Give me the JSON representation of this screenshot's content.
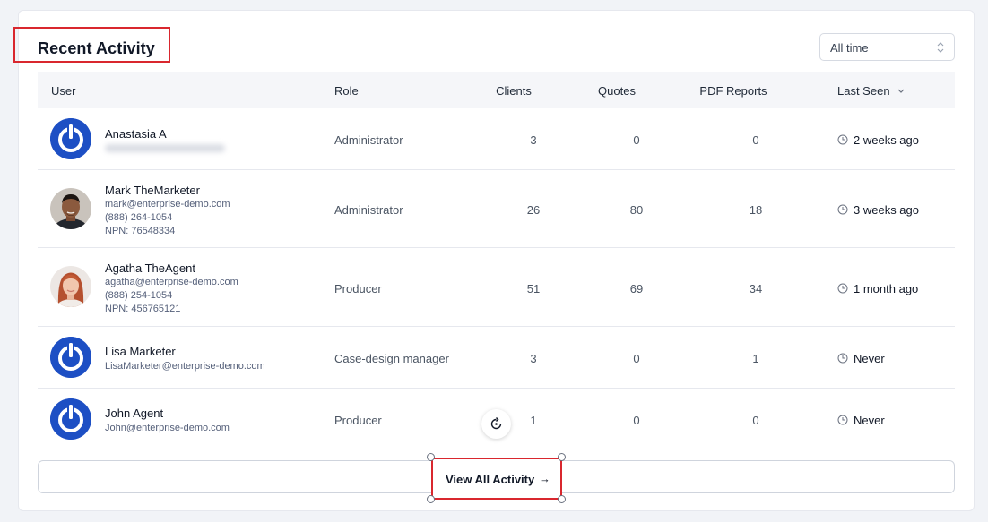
{
  "card": {
    "title": "Recent Activity",
    "time_filter": {
      "value": "All time"
    }
  },
  "table": {
    "columns": {
      "user": "User",
      "role": "Role",
      "clients": "Clients",
      "quotes": "Quotes",
      "pdf_reports": "PDF Reports",
      "last_seen": "Last Seen"
    },
    "rows": [
      {
        "name": "Anastasia A",
        "email": "",
        "phone": "",
        "npn": "",
        "role": "Administrator",
        "clients": "3",
        "quotes": "0",
        "pdf_reports": "0",
        "last_seen": "2 weeks ago",
        "avatar": "power-icon"
      },
      {
        "name": "Mark TheMarketer",
        "email": "mark@enterprise-demo.com",
        "phone": "(888) 264-1054",
        "npn": "NPN: 76548334",
        "role": "Administrator",
        "clients": "26",
        "quotes": "80",
        "pdf_reports": "18",
        "last_seen": "3 weeks ago",
        "avatar": "photo-man"
      },
      {
        "name": "Agatha TheAgent",
        "email": "agatha@enterprise-demo.com",
        "phone": "(888) 254-1054",
        "npn": "NPN: 456765121",
        "role": "Producer",
        "clients": "51",
        "quotes": "69",
        "pdf_reports": "34",
        "last_seen": "1 month ago",
        "avatar": "photo-woman"
      },
      {
        "name": "Lisa Marketer",
        "email": "LisaMarketer@enterprise-demo.com",
        "phone": "",
        "npn": "",
        "role": "Case-design manager",
        "clients": "3",
        "quotes": "0",
        "pdf_reports": "1",
        "last_seen": "Never",
        "avatar": "power-icon"
      },
      {
        "name": "John Agent",
        "email": "John@enterprise-demo.com",
        "phone": "",
        "npn": "",
        "role": "Producer",
        "clients": "1",
        "quotes": "0",
        "pdf_reports": "0",
        "last_seen": "Never",
        "avatar": "power-icon"
      }
    ]
  },
  "footer": {
    "view_all_label": "View All Activity",
    "arrow": "→"
  },
  "colors": {
    "accent": "#1d4fc4",
    "highlight": "#d9272e"
  }
}
